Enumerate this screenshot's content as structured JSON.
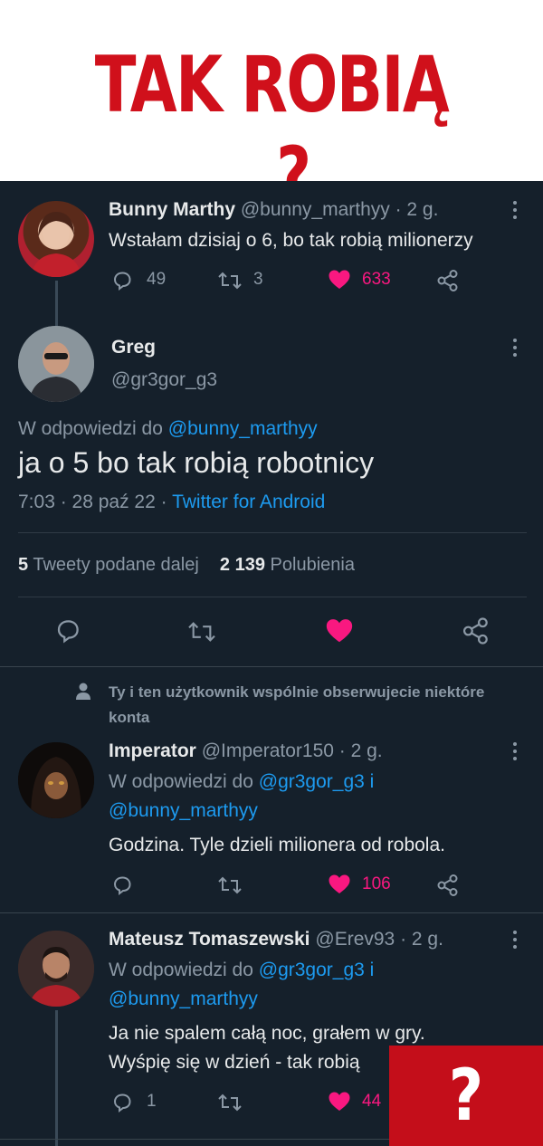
{
  "banner": {
    "title": "TAK ROBIĄ ..?"
  },
  "colors": {
    "bg": "#15202b",
    "accent": "#1d9bf0",
    "like": "#f91880",
    "banner_red": "#d0101b"
  },
  "tweet1": {
    "name": "Bunny Marthy",
    "meta": "@bunny_marthyy · 2 g.",
    "text": "Wstałam dzisiaj o 6, bo tak robią milionerzy",
    "replies": "49",
    "retweets": "3",
    "likes": "633"
  },
  "main_tweet": {
    "name": "Greg",
    "handle": "@gr3gor_g3",
    "reply_prefix": "W odpowiedzi do",
    "reply_to": "@bunny_marthyy",
    "text": "ja o 5 bo tak robią robotnicy",
    "timestamp": "7:03 · 28 paź 22 ·",
    "client": "Twitter for Android",
    "retweet_count": "5",
    "retweet_label": "Tweety podane dalej",
    "like_count": "2 139",
    "like_label": "Polubienia"
  },
  "follow_notice": "Ty i ten użytkownik wspólnie obserwujecie niektóre konta",
  "reply1": {
    "name": "Imperator",
    "meta": "@Imperator150 · 2 g.",
    "reply_prefix": "W odpowiedzi do",
    "reply_to1": "@gr3gor_g3",
    "reply_join": "i",
    "reply_to2": "@bunny_marthyy",
    "text": "Godzina. Tyle dzieli milionera od robola.",
    "likes": "106"
  },
  "reply2": {
    "name": "Mateusz Tomaszewski",
    "meta": "@Erev93 · 2 g.",
    "reply_prefix": "W odpowiedzi do",
    "reply_to1": "@gr3gor_g3",
    "reply_join": "i",
    "reply_to2": "@bunny_marthyy",
    "text_line1": "Ja nie spalem całą noc, grałem w gry.",
    "text_line2": "Wyśpię się w dzień - tak robią",
    "replies": "1",
    "likes": "44"
  },
  "overlay": {
    "mark": "?"
  }
}
